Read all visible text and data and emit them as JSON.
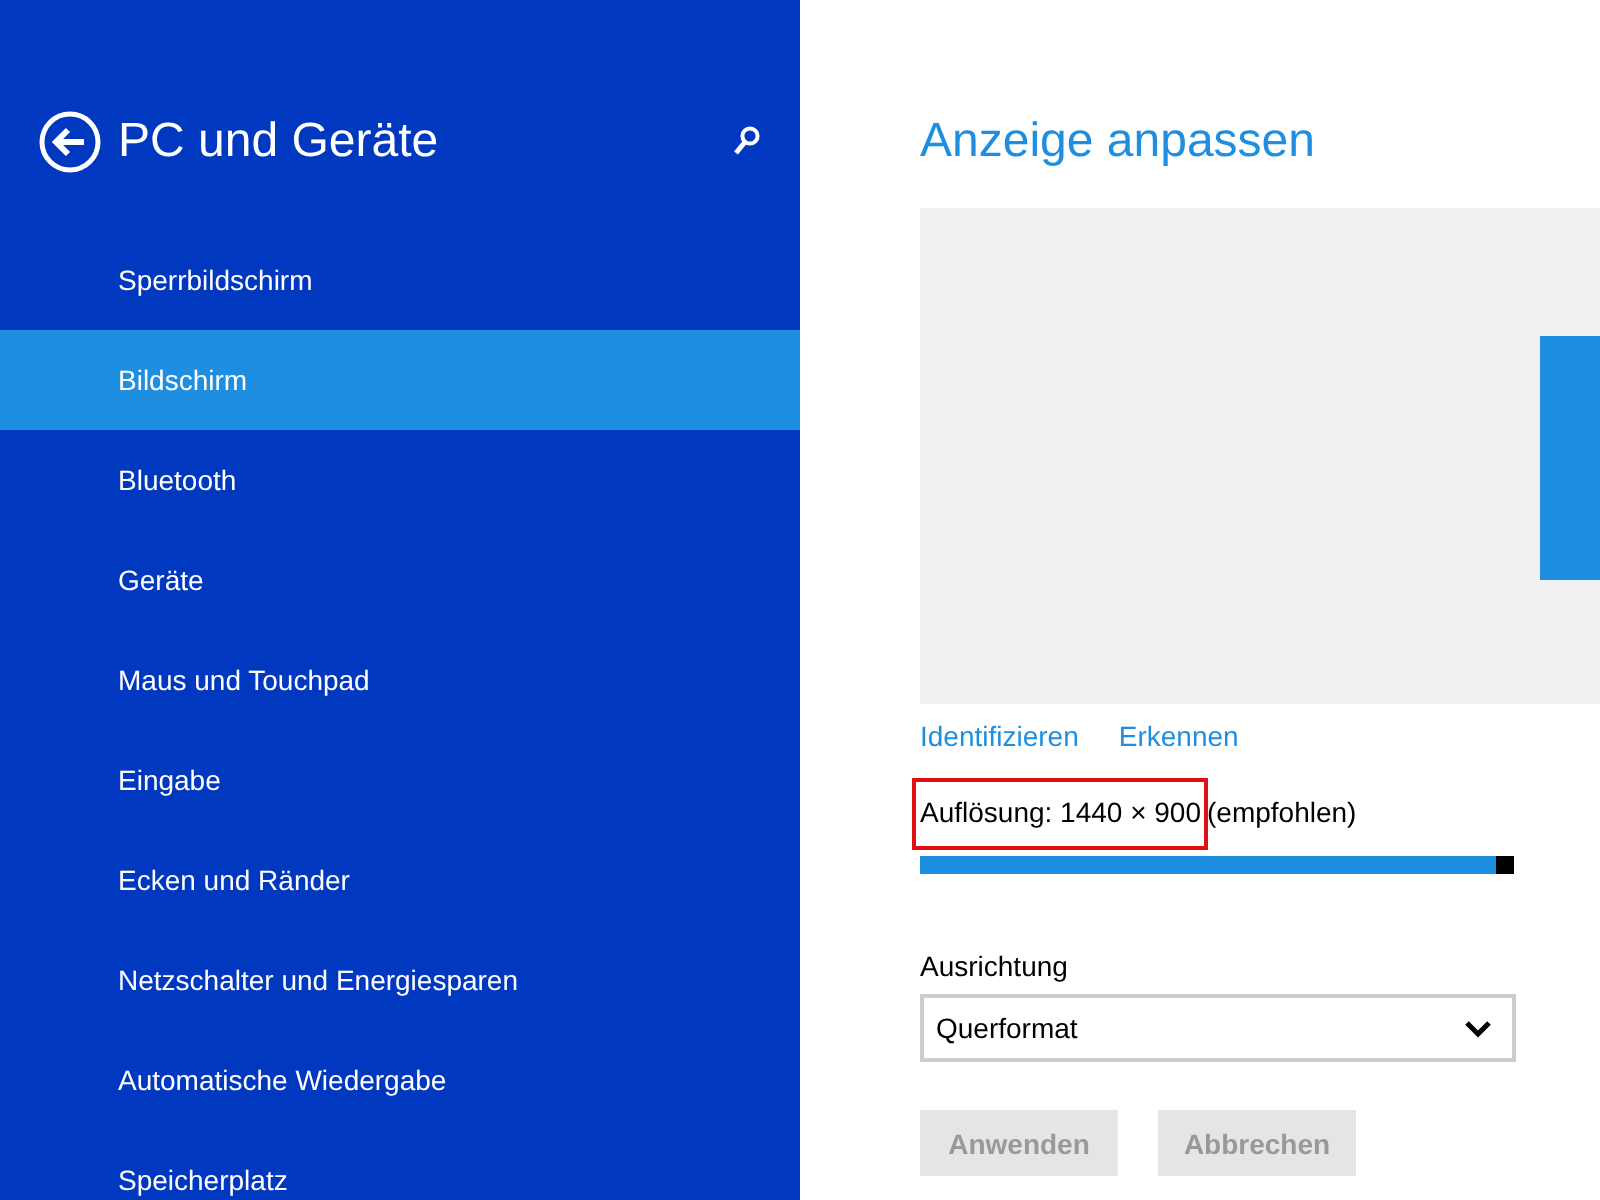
{
  "sidebar": {
    "title": "PC und Geräte",
    "items": [
      {
        "label": "Sperrbildschirm",
        "selected": false
      },
      {
        "label": "Bildschirm",
        "selected": true
      },
      {
        "label": "Bluetooth",
        "selected": false
      },
      {
        "label": "Geräte",
        "selected": false
      },
      {
        "label": "Maus und Touchpad",
        "selected": false
      },
      {
        "label": "Eingabe",
        "selected": false
      },
      {
        "label": "Ecken und Ränder",
        "selected": false
      },
      {
        "label": "Netzschalter und Energiesparen",
        "selected": false
      },
      {
        "label": "Automatische Wiedergabe",
        "selected": false
      },
      {
        "label": "Speicherplatz",
        "selected": false
      }
    ]
  },
  "main": {
    "title": "Anzeige anpassen",
    "links": [
      "Identifizieren",
      "Erkennen"
    ],
    "resolution": {
      "label": "Auflösung: 1440 × 900",
      "note": "(empfohlen)",
      "highlighted": true,
      "level": 1
    },
    "orientation": {
      "label": "Ausrichtung",
      "value": "Querformat"
    },
    "buttons": [
      {
        "label": "Anwenden",
        "disabled": true
      },
      {
        "label": "Abbrechen",
        "disabled": true
      }
    ]
  }
}
